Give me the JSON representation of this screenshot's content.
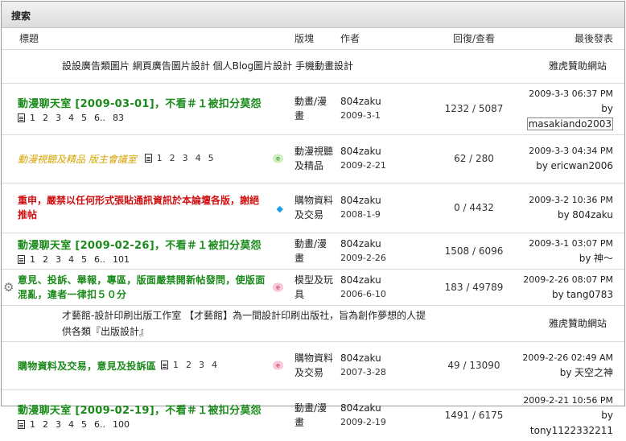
{
  "header": {
    "title": "搜索"
  },
  "columns": {
    "title": "標題",
    "forum": "版塊",
    "author": "作者",
    "stats": "回復/查看",
    "last": "最後發表"
  },
  "ad1": {
    "text": "設設廣告類圖片 網頁廣告圖片設計 個人Blog圖片設計 手機動畫設計",
    "sponsor": "雅虎贊助網站"
  },
  "ad2": {
    "text": "才藝館-設計印刷出版工作室 【才藝館】為一間設計印刷出版社，旨為創作夢想的人提供各類『出版設計』",
    "sponsor": "雅虎贊助網站"
  },
  "threads": [
    {
      "title": "動漫聊天室 [2009-03-01]，不看＃１被扣分莫怨",
      "pages": [
        "1",
        "2",
        "3",
        "4",
        "5",
        "6..",
        "83"
      ],
      "forum": "動畫/漫畫",
      "author": "804zaku",
      "date": "2009-3-1",
      "replies": "1232",
      "views": "5087",
      "last_time": "2009-3-3 06:37 PM",
      "last_by": "by",
      "last_poster": "masakiando2003"
    },
    {
      "title": "動漫視聽及精品 版主會議室",
      "pages": [
        "1",
        "2",
        "3",
        "4",
        "5"
      ],
      "forum": "動漫視聽及精品",
      "author": "804zaku",
      "date": "2009-2-21",
      "replies": "62",
      "views": "280",
      "last_time": "2009-3-3 04:34 PM",
      "last_by": "by",
      "last_poster": "ericwan2006"
    },
    {
      "title": "重申，嚴禁以任何形式張貼通訊資訊於本論壇各版，謝絕推帖",
      "pages": [],
      "forum": "購物資料及交易",
      "author": "804zaku",
      "date": "2008-1-9",
      "replies": "0",
      "views": "4432",
      "last_time": "2009-3-2 10:36 PM",
      "last_by": "by",
      "last_poster": "804zaku"
    },
    {
      "title": "動漫聊天室 [2009-02-26]，不看＃１被扣分莫怨",
      "pages": [
        "1",
        "2",
        "3",
        "4",
        "5",
        "6..",
        "101"
      ],
      "forum": "動畫/漫畫",
      "author": "804zaku",
      "date": "2009-2-26",
      "replies": "1508",
      "views": "6096",
      "last_time": "2009-3-1 03:07 PM",
      "last_by": "by",
      "last_poster": "神～"
    },
    {
      "title": "意見、投訴、舉報，專區，版面嚴禁開新帖發問，使版面混亂，違者一律扣５０分",
      "pages": [],
      "forum": "模型及玩具",
      "author": "804zaku",
      "date": "2006-6-10",
      "replies": "183",
      "views": "49789",
      "last_time": "2009-2-26 08:07 PM",
      "last_by": "by",
      "last_poster": "tang0783"
    },
    {
      "title": "購物資料及交易，意見及投訴區",
      "pages": [
        "1",
        "2",
        "3",
        "4"
      ],
      "forum": "購物資料及交易",
      "author": "804zaku",
      "date": "2007-3-28",
      "replies": "49",
      "views": "13090",
      "last_time": "2009-2-26 02:49 AM",
      "last_by": "by",
      "last_poster": "天空之神"
    },
    {
      "title": "動漫聊天室 [2009-02-19]，不看＃１被扣分莫怨",
      "pages": [
        "1",
        "2",
        "3",
        "4",
        "5",
        "6..",
        "100"
      ],
      "forum": "動畫/漫畫",
      "author": "804zaku",
      "date": "2009-2-19",
      "replies": "1491",
      "views": "6175",
      "last_time": "2009-2-21 10:56 PM",
      "last_by": "by",
      "last_poster": "tony1122332211"
    }
  ],
  "icons": {
    "tag": "tag-icon",
    "diamond": "diamond-icon",
    "gear": "gear-icon",
    "doc": "multipage-icon"
  }
}
